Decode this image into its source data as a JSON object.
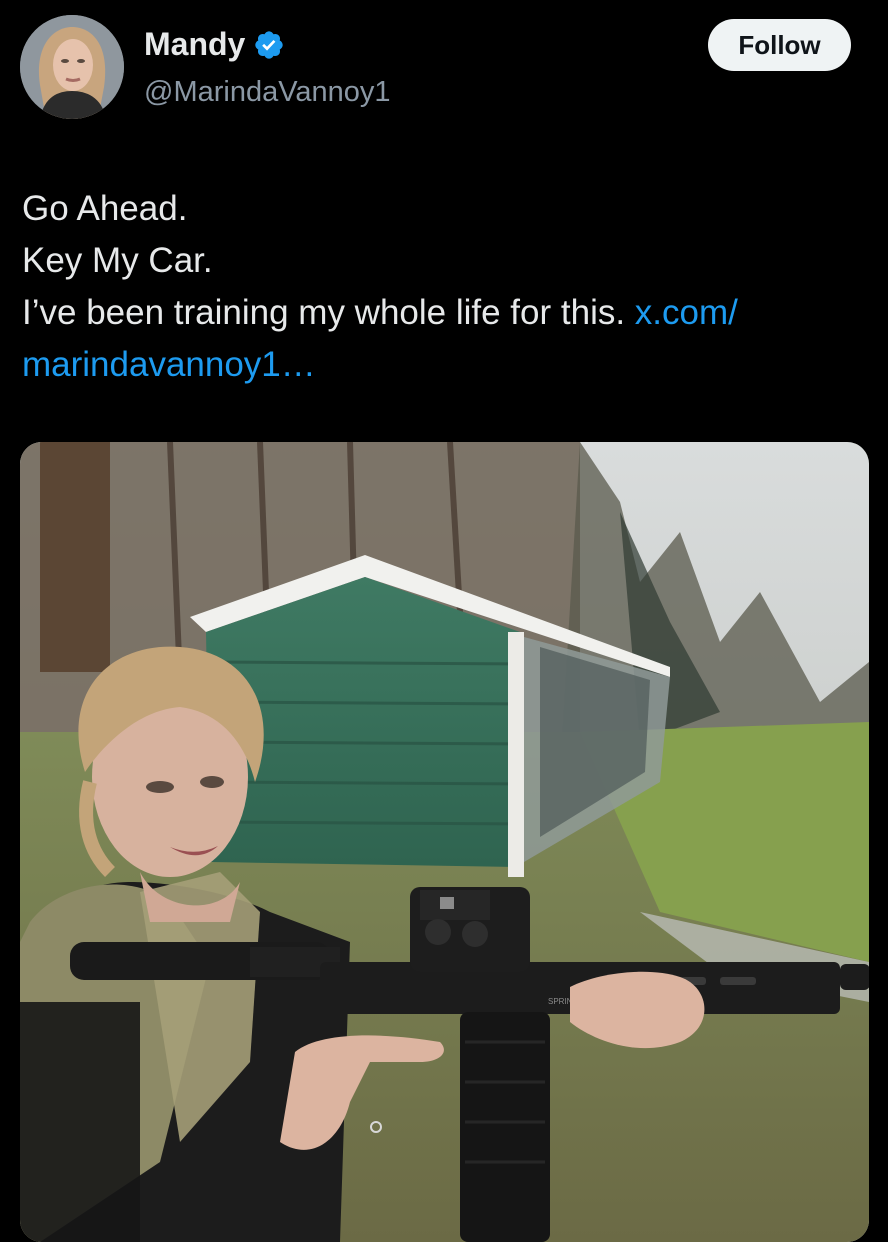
{
  "author": {
    "display_name": "Mandy",
    "handle": "@MarindaVannoy1",
    "verified": true
  },
  "follow_button": {
    "label": "Follow"
  },
  "tweet": {
    "line1": "Go Ahead.",
    "line2": "Key My Car.",
    "line3_text": "I’ve been training my whole life for this. ",
    "line3_link": "x.com/",
    "line4_link": "marindavannoy1…"
  },
  "media": {
    "rifle_markings": "SPRINGFIELD"
  },
  "colors": {
    "background": "#000000",
    "text": "#e7e9ea",
    "secondary_text": "#8b98a5",
    "link": "#1d9bf0",
    "verified_badge": "#1d9bf0",
    "follow_bg": "#eff3f4"
  },
  "icons": {
    "verified": "verified-badge-icon"
  }
}
